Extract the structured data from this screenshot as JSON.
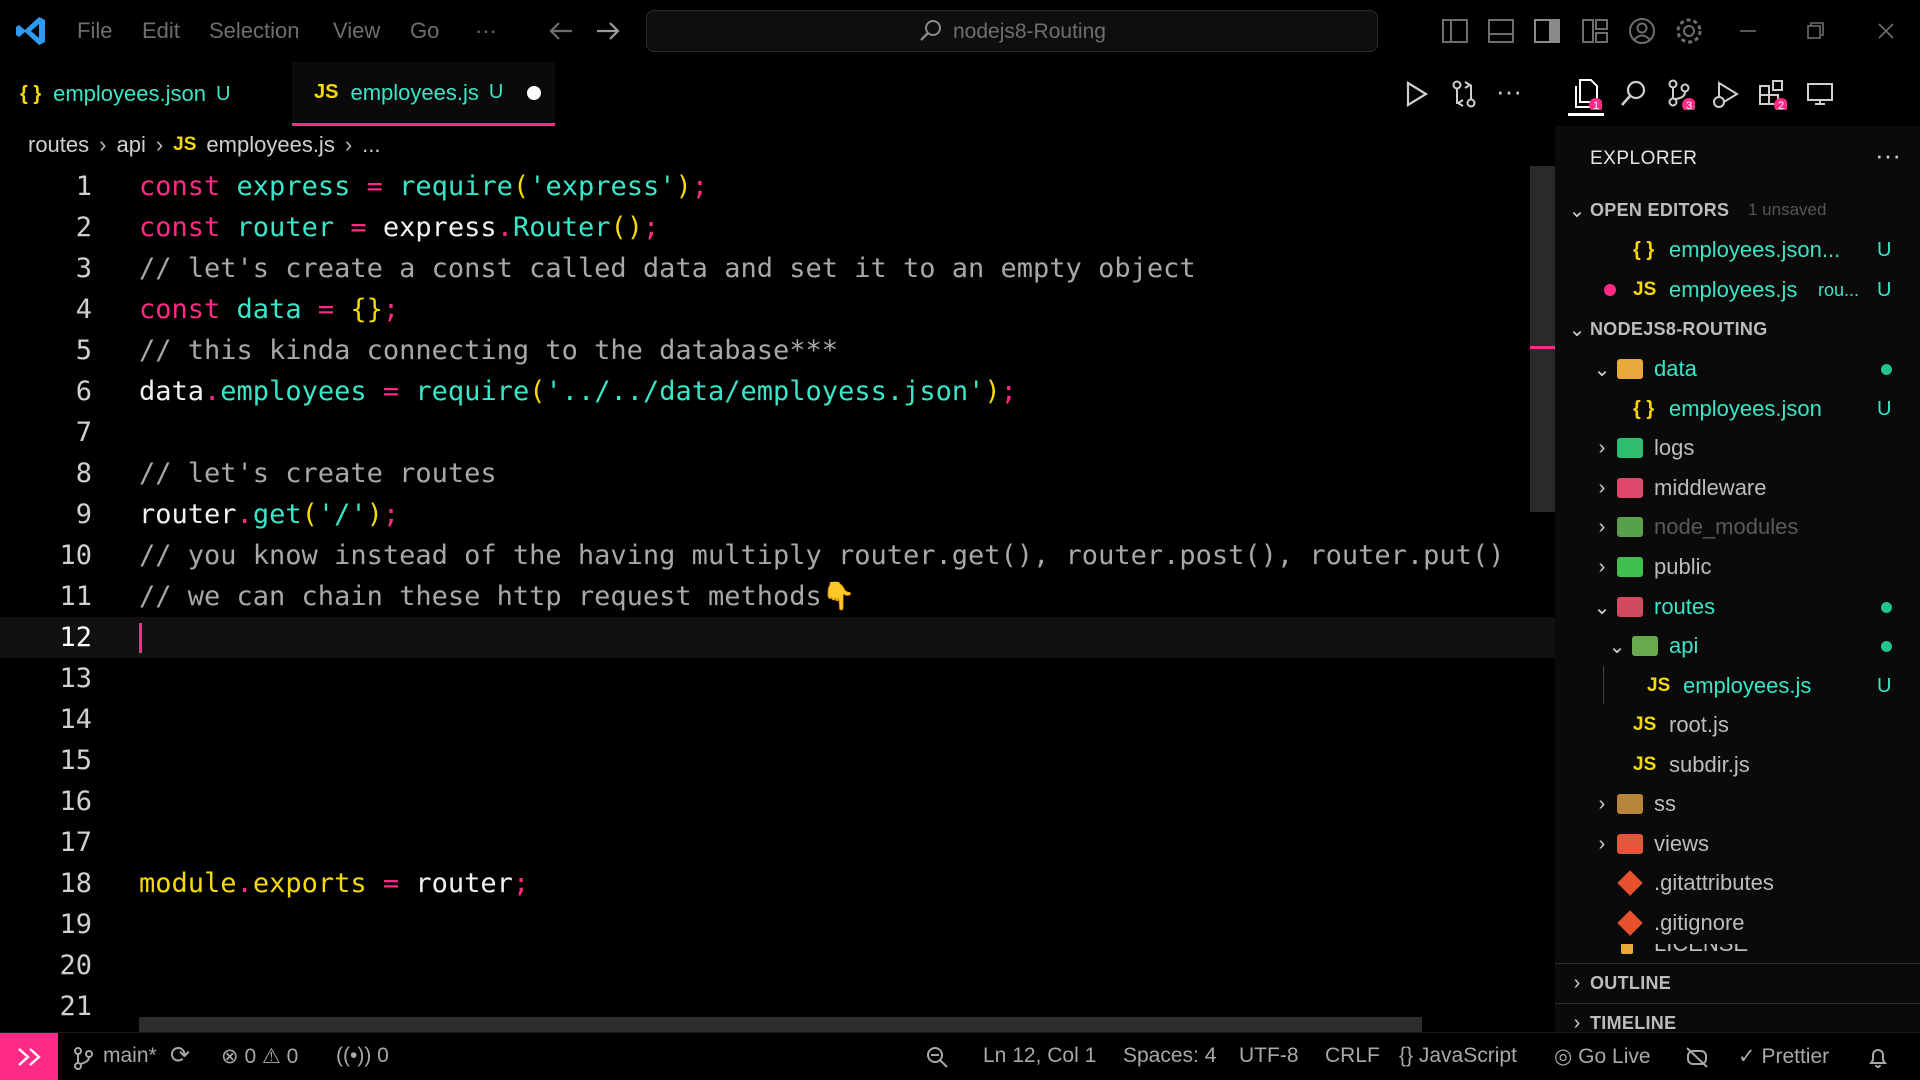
{
  "titlebar": {
    "menu": [
      "File",
      "Edit",
      "Selection",
      "View",
      "Go",
      "···"
    ],
    "search_text": "nodejs8-Routing"
  },
  "tabs": [
    {
      "icon": "{ }",
      "name": "employees.json",
      "status": "U"
    },
    {
      "icon": "JS",
      "name": "employees.js",
      "status": "U"
    }
  ],
  "tab_actions": [
    "run-icon",
    "git-compare-icon",
    "more-icon"
  ],
  "activity": {
    "explorer_badge": "1",
    "scm_badge": "3",
    "extensions_badge": "2"
  },
  "breadcrumb": {
    "items": [
      "routes",
      "api",
      "employees.js",
      "..."
    ],
    "file_icon": "JS"
  },
  "editor": {
    "current_line": 12,
    "line_numbers": [
      "1",
      "2",
      "3",
      "4",
      "5",
      "6",
      "7",
      "8",
      "9",
      "10",
      "11",
      "12",
      "13",
      "14",
      "15",
      "16",
      "17",
      "18",
      "19",
      "20",
      "21"
    ],
    "lines": {
      "l1": [
        "const",
        "express",
        "=",
        "require",
        "(",
        "'express'",
        ")",
        ";"
      ],
      "l2": [
        "const",
        "router",
        "=",
        "express",
        ".",
        "Router",
        "()",
        ";"
      ],
      "l3": "// let's create a const called data and set it to an empty object",
      "l4": [
        "const",
        "data",
        "=",
        "{}",
        ";"
      ],
      "l5": "// this kinda connecting to the database***",
      "l6": [
        "data",
        ".",
        "employees",
        "=",
        "require",
        "(",
        "'../../data/employess.json'",
        ")",
        ";"
      ],
      "l8": "// let's create routes",
      "l9": [
        "router",
        ".",
        "get",
        "(",
        "'/'",
        ")",
        ";"
      ],
      "l10": "// you know instead of the having multiply router.get(), router.post(), router.put()",
      "l11": "// we can chain these http request methods",
      "l11_emoji": "👇",
      "l18": [
        "module",
        ".",
        "exports",
        "=",
        "router",
        ";"
      ]
    }
  },
  "sidebar": {
    "title": "EXPLORER",
    "open_editors": {
      "label": "OPEN EDITORS",
      "note": "1 unsaved",
      "items": [
        {
          "icon": "{ }",
          "name": "employees.json...",
          "status": "U"
        },
        {
          "icon": "JS",
          "name": "employees.js",
          "dir": "rou...",
          "status": "U"
        }
      ]
    },
    "project": {
      "label": "NODEJS8-ROUTING",
      "items": [
        {
          "name": "data"
        },
        {
          "name": "employees.json",
          "status": "U"
        },
        {
          "name": "logs"
        },
        {
          "name": "middleware"
        },
        {
          "name": "node_modules"
        },
        {
          "name": "public"
        },
        {
          "name": "routes"
        },
        {
          "name": "api"
        },
        {
          "name": "employees.js",
          "status": "U"
        },
        {
          "name": "root.js"
        },
        {
          "name": "subdir.js"
        },
        {
          "name": "ss"
        },
        {
          "name": "views"
        },
        {
          "name": ".gitattributes"
        },
        {
          "name": ".gitignore"
        },
        {
          "name": "LICENSE"
        }
      ]
    },
    "outline": "OUTLINE",
    "timeline": "TIMELINE"
  },
  "statusbar": {
    "branch": "main*",
    "errors": "0",
    "warnings": "0",
    "ports": "0",
    "position": "Ln 12, Col 1",
    "spaces": "Spaces: 4",
    "encoding": "UTF-8",
    "eol": "CRLF",
    "language": "JavaScript",
    "golive": "Go Live",
    "prettier": "Prettier"
  },
  "colors": {
    "accent": "#ff2a85",
    "teal": "#39e6c8",
    "yellow": "#f5d90a"
  }
}
